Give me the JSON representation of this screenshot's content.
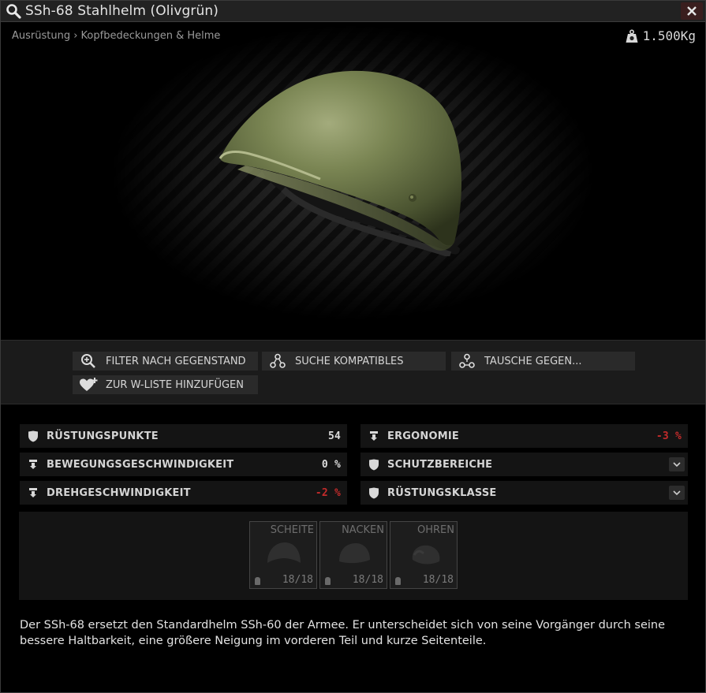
{
  "window": {
    "title": "SSh-68 Stahlhelm (Olivgrün)",
    "breadcrumb": "Ausrüstung › Kopfbedeckungen & Helme",
    "weight": "1.500Kg"
  },
  "actions": {
    "filter": "FILTER NACH GEGENSTAND",
    "compatible": "SUCHE KOMPATIBLES",
    "trade": "TAUSCHE GEGEN...",
    "wishlist": "ZUR W-LISTE HINZUFÜGEN"
  },
  "stats": {
    "armor_points": {
      "label": "RÜSTUNGSPUNKTE",
      "value": "54"
    },
    "ergonomics": {
      "label": "ERGONOMIE",
      "value": "-3 %"
    },
    "move_speed": {
      "label": "BEWEGUNGSGESCHWINDIGKEIT",
      "value": "0 %"
    },
    "protection_zones": {
      "label": "SCHUTZBEREICHE"
    },
    "turn_speed": {
      "label": "DREHGESCHWINDIGKEIT",
      "value": "-2 %"
    },
    "armor_class": {
      "label": "RÜSTUNGSKLASSE"
    }
  },
  "slots": [
    {
      "name": "SCHEITE",
      "count": "18/18"
    },
    {
      "name": "NACKEN",
      "count": "18/18"
    },
    {
      "name": "OHREN",
      "count": "18/18"
    }
  ],
  "description": "Der SSh-68 ersetzt den Standardhelm SSh-60 der Armee. Er unterscheidet sich von seine Vorgänger durch seine bessere Haltbarkeit, eine größere Neigung im vorderen Teil und kurze Seitenteile.",
  "colors": {
    "negative": "#c32b2b",
    "helmet": "#6f7a4a",
    "close_bg": "#3a1e1e"
  }
}
